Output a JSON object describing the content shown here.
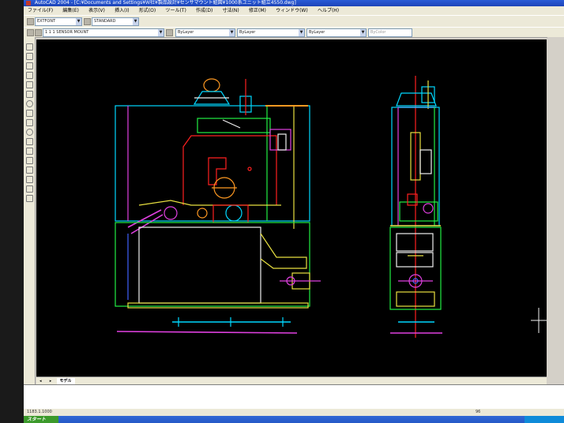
{
  "window": {
    "title": "AutoCAD 2004 - [C:¥Documents and Settings¥Ｗ社¥製品設計¥センサマウント組図¥1000系ユニット組立4550.dwg]"
  },
  "menu": {
    "items": [
      "ファイル(F)",
      "編集(E)",
      "表示(V)",
      "挿入(I)",
      "形式(O)",
      "ツール(T)",
      "作成(D)",
      "寸法(N)",
      "修正(M)",
      "ウィンドウ(W)",
      "ヘルプ(H)"
    ]
  },
  "toolbar": {
    "text_style": "EXTFONT",
    "dim_style": "STANDARD",
    "layer": "1 1 1 SENSOR MOUNT",
    "color": "ByLayer",
    "linetype": "ByLayer",
    "lineweight": "ByLayer",
    "plotstyle": "ByColor"
  },
  "tabs": [
    "モデル"
  ],
  "statusbar": {
    "coords": "1183.1.1000",
    "mode": "96"
  },
  "taskbar": {
    "start_label": "スタート"
  },
  "colors": {
    "viewport_bg": "#000000",
    "cyan": "#00d8ff",
    "green": "#22ee44",
    "magenta": "#e040e0",
    "yellow": "#e8e040",
    "red": "#ff2020",
    "white": "#f0f0f0",
    "orange": "#ff9922",
    "blue": "#4060ff"
  }
}
